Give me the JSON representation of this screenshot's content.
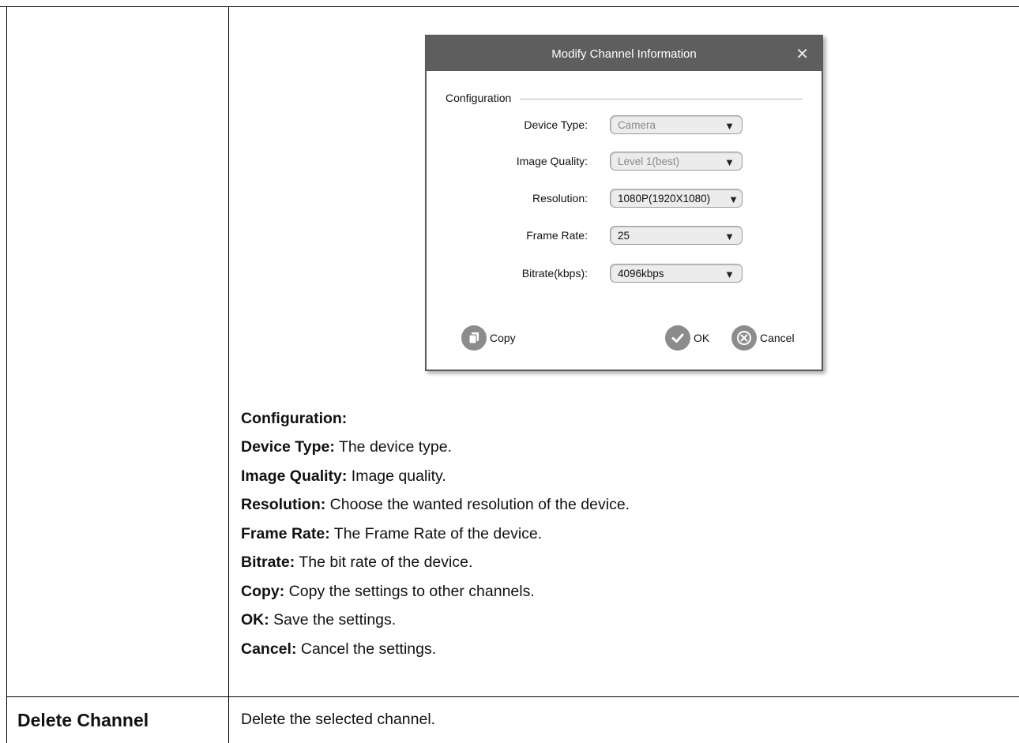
{
  "dialog": {
    "title": "Modify Channel Information",
    "group_label": "Configuration",
    "fields": [
      {
        "label": "Device Type:",
        "value": "Camera",
        "disabled": true
      },
      {
        "label": "Image Quality:",
        "value": "Level 1(best)",
        "disabled": true
      },
      {
        "label": "Resolution:",
        "value": "1080P(1920X1080)",
        "disabled": false
      },
      {
        "label": "Frame Rate:",
        "value": "25",
        "disabled": false
      },
      {
        "label": "Bitrate(kbps):",
        "value": "4096kbps",
        "disabled": false
      }
    ],
    "buttons": {
      "copy": "Copy",
      "ok": "OK",
      "cancel": "Cancel"
    },
    "icons": [
      "close-icon",
      "dropdown-arrow-icon",
      "copy-icon",
      "check-icon",
      "cancel-icon"
    ],
    "colors": {
      "titlebar": "#5e5e5e",
      "button_circle": "#8c8c8c"
    }
  },
  "doc": {
    "heading": "Configuration:",
    "items": [
      {
        "term": "Device Type:",
        "desc": " The device type."
      },
      {
        "term": "Image Quality:",
        "desc": " Image quality."
      },
      {
        "term": "Resolution:",
        "desc": " Choose the wanted resolution of the device."
      },
      {
        "term": "Frame Rate:",
        "desc": " The Frame Rate of the device."
      },
      {
        "term": "Bitrate:",
        "desc": " The bit rate of the device."
      },
      {
        "term": "Copy:",
        "desc": " Copy the settings to other channels."
      },
      {
        "term": "OK:",
        "desc": " Save the settings."
      },
      {
        "term": "Cancel:",
        "desc": " Cancel the settings."
      }
    ]
  },
  "table_row": {
    "label": "Delete Channel",
    "description": "Delete the selected channel."
  }
}
